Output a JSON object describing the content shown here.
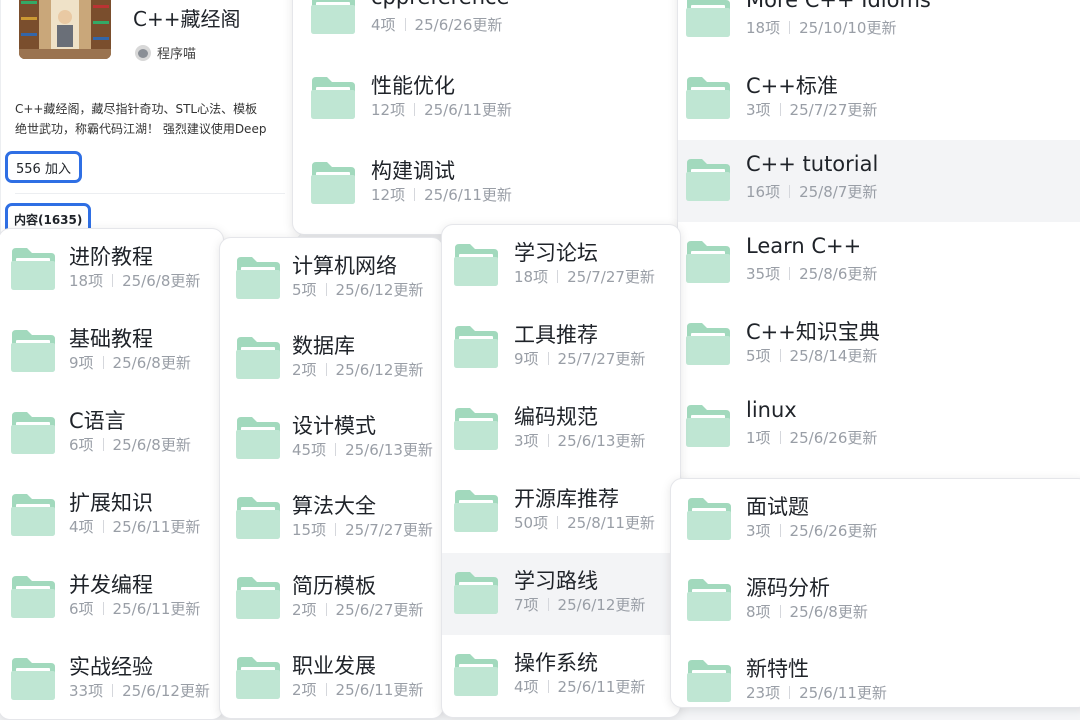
{
  "group": {
    "title": "C++藏经阁",
    "owner": "程序喵",
    "description_line1": "C++藏经阁，藏尽指针奇功、STL心法、模板",
    "description_line2": "绝世武功，称霸代码江湖！ 强烈建议使用Deep",
    "members_label": "556 加入",
    "content_tab": "内容(1635)"
  },
  "colors": {
    "accent": "#2f6fe4",
    "folder_back": "#a2d9bd",
    "folder_front": "#bfe6d3",
    "folder_paper": "#ffffff"
  },
  "icons": {
    "folder": "folder-icon",
    "owner": "avatar-icon"
  },
  "panels": [
    {
      "folders": [
        {
          "name": "cppreference",
          "count": "4项",
          "updated": "25/6/26更新"
        },
        {
          "name": "性能优化",
          "count": "12项",
          "updated": "25/6/11更新"
        },
        {
          "name": "构建调试",
          "count": "12项",
          "updated": "25/6/11更新"
        }
      ]
    },
    {
      "folders": [
        {
          "name": "More C++ Idioms",
          "count": "18项",
          "updated": "25/10/10更新"
        },
        {
          "name": "C++标准",
          "count": "3项",
          "updated": "25/7/27更新"
        },
        {
          "name": "C++ tutorial",
          "count": "16项",
          "updated": "25/8/7更新",
          "highlighted": true
        },
        {
          "name": "Learn C++",
          "count": "35项",
          "updated": "25/8/6更新"
        },
        {
          "name": "C++知识宝典",
          "count": "5项",
          "updated": "25/8/14更新"
        },
        {
          "name": "linux",
          "count": "1项",
          "updated": "25/6/26更新"
        }
      ]
    },
    {
      "folders": [
        {
          "name": "进阶教程",
          "count": "18项",
          "updated": "25/6/8更新"
        },
        {
          "name": "基础教程",
          "count": "9项",
          "updated": "25/6/8更新"
        },
        {
          "name": "C语言",
          "count": "6项",
          "updated": "25/6/8更新"
        },
        {
          "name": "扩展知识",
          "count": "4项",
          "updated": "25/6/11更新"
        },
        {
          "name": "并发编程",
          "count": "6项",
          "updated": "25/6/11更新"
        },
        {
          "name": "实战经验",
          "count": "33项",
          "updated": "25/6/12更新"
        }
      ]
    },
    {
      "folders": [
        {
          "name": "计算机网络",
          "count": "5项",
          "updated": "25/6/12更新"
        },
        {
          "name": "数据库",
          "count": "2项",
          "updated": "25/6/12更新"
        },
        {
          "name": "设计模式",
          "count": "45项",
          "updated": "25/6/13更新"
        },
        {
          "name": "算法大全",
          "count": "15项",
          "updated": "25/7/27更新"
        },
        {
          "name": "简历模板",
          "count": "2项",
          "updated": "25/6/27更新"
        },
        {
          "name": "职业发展",
          "count": "2项",
          "updated": "25/6/11更新"
        }
      ]
    },
    {
      "folders": [
        {
          "name": "学习论坛",
          "count": "18项",
          "updated": "25/7/27更新"
        },
        {
          "name": "工具推荐",
          "count": "9项",
          "updated": "25/7/27更新"
        },
        {
          "name": "编码规范",
          "count": "3项",
          "updated": "25/6/13更新"
        },
        {
          "name": "开源库推荐",
          "count": "50项",
          "updated": "25/8/11更新"
        },
        {
          "name": "学习路线",
          "count": "7项",
          "updated": "25/6/12更新",
          "highlighted": true
        },
        {
          "name": "操作系统",
          "count": "4项",
          "updated": "25/6/11更新"
        }
      ]
    },
    {
      "folders": [
        {
          "name": "面试题",
          "count": "3项",
          "updated": "25/6/26更新"
        },
        {
          "name": "源码分析",
          "count": "8项",
          "updated": "25/6/8更新"
        },
        {
          "name": "新特性",
          "count": "23项",
          "updated": "25/6/11更新"
        }
      ]
    }
  ]
}
